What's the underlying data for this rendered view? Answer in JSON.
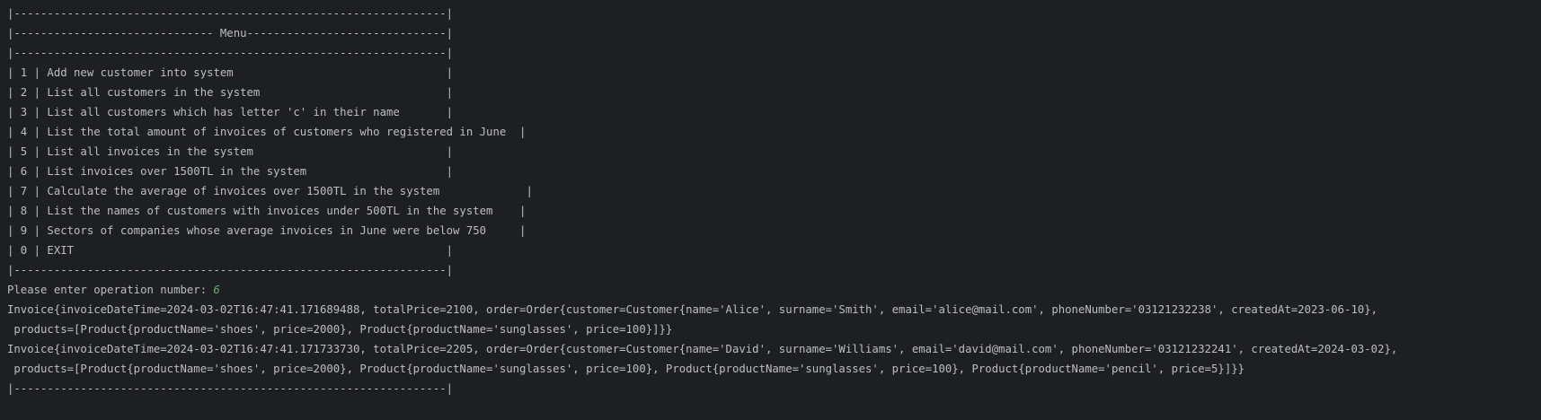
{
  "console": {
    "menu_lines": [
      "|-----------------------------------------------------------------|",
      "|------------------------------ Menu------------------------------|",
      "|-----------------------------------------------------------------|",
      "| 1 | Add new customer into system                                |",
      "| 2 | List all customers in the system                            |",
      "| 3 | List all customers which has letter 'c' in their name       |",
      "| 4 | List the total amount of invoices of customers who registered in June  |",
      "| 5 | List all invoices in the system                             |",
      "| 6 | List invoices over 1500TL in the system                     |",
      "| 7 | Calculate the average of invoices over 1500TL in the system             |",
      "| 8 | List the names of customers with invoices under 500TL in the system    |",
      "| 9 | Sectors of companies whose average invoices in June were below 750     |",
      "| 0 | EXIT                                                        |",
      "|-----------------------------------------------------------------|"
    ],
    "prompt_label": "Please enter operation number: ",
    "prompt_value": "6",
    "output_lines": [
      "Invoice{invoiceDateTime=2024-03-02T16:47:41.171689488, totalPrice=2100, order=Order{customer=Customer{name='Alice', surname='Smith', email='alice@mail.com', phoneNumber='03121232238', createdAt=2023-06-10},",
      " products=[Product{productName='shoes', price=2000}, Product{productName='sunglasses', price=100}]}}",
      "Invoice{invoiceDateTime=2024-03-02T16:47:41.171733730, totalPrice=2205, order=Order{customer=Customer{name='David', surname='Williams', email='david@mail.com', phoneNumber='03121232241', createdAt=2024-03-02},",
      " products=[Product{productName='shoes', price=2000}, Product{productName='sunglasses', price=100}, Product{productName='sunglasses', price=100}, Product{productName='pencil', price=5}]}}",
      "|-----------------------------------------------------------------|"
    ],
    "colors": {
      "background": "#1e1f22",
      "text": "#bcbec4",
      "user_input": "#6aab73"
    }
  }
}
